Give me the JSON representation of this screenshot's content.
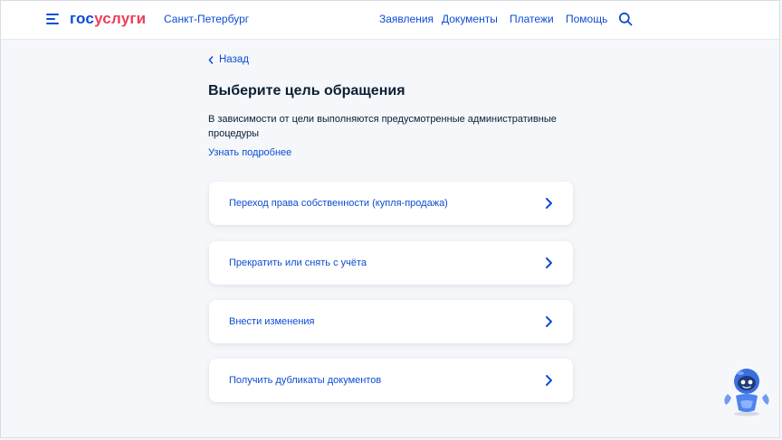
{
  "header": {
    "logo": {
      "part1": "гос",
      "part2": "услуги"
    },
    "city": "Санкт-Петербург",
    "nav": [
      "Заявления",
      "Документы",
      "Платежи",
      "Помощь"
    ],
    "icons": {
      "menu": "menu-icon",
      "search": "search-icon"
    }
  },
  "main": {
    "back_label": "Назад",
    "title": "Выберите цель обращения",
    "description": "В зависимости от цели выполняются предусмотренные административные процедуры",
    "learn_more": "Узнать подробнее",
    "options": [
      "Переход права собственности (купля-продажа)",
      "Прекратить или снять с учёта",
      "Внести изменения",
      "Получить дубликаты документов"
    ]
  },
  "assistant": {
    "icon": "robot-assistant-icon"
  },
  "colors": {
    "accent": "#0d4cd3",
    "brand_red": "#ee3f58",
    "background": "#f5f7fa",
    "text": "#0b1f33"
  }
}
